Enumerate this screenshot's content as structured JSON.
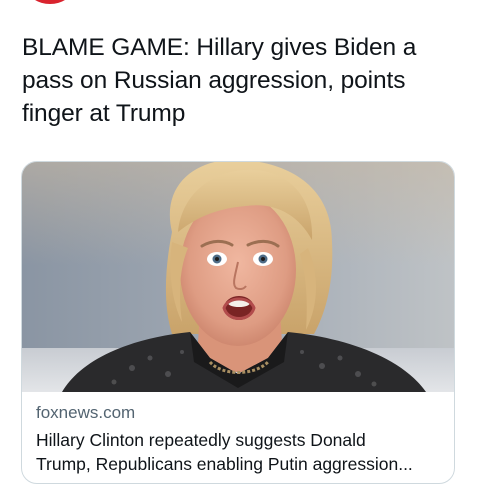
{
  "tweet": {
    "text": "BLAME GAME: Hillary gives Biden a pass on Russian aggression, points finger at Trump"
  },
  "card": {
    "image_alt": "Photo of Hillary Clinton speaking with an open mouth in front of a blurred background",
    "domain": "foxnews.com",
    "title_line1": "Hillary Clinton repeatedly suggests Donald",
    "title_line2": "Trump, Republicans enabling Putin aggression..."
  },
  "colors": {
    "text": "#0f1419",
    "secondary_text": "#536471",
    "card_border": "#cfd9de",
    "avatar_red": "#d9232e"
  }
}
